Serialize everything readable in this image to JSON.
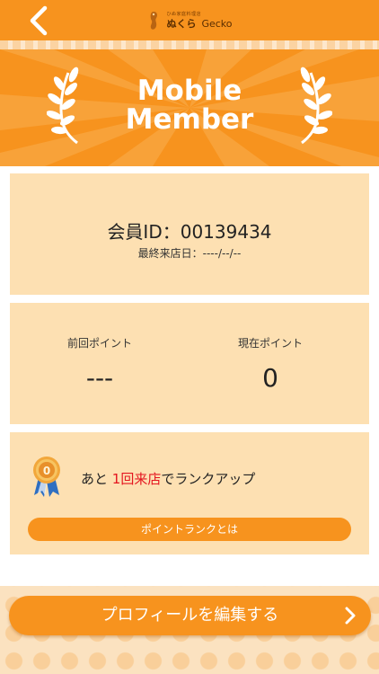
{
  "header": {
    "back_icon": "chevron-left-icon",
    "logo": {
      "small_text": "ひぬ家庭料理店",
      "name_jp": "ぬくら",
      "name_en": "Gecko"
    }
  },
  "banner": {
    "title_line1": "Mobile",
    "title_line2": "Member",
    "icon": "laurel-wreath-icon"
  },
  "member": {
    "id_text": "会員ID：00139434",
    "last_visit_text": "最終来店日：----/--/--"
  },
  "points": {
    "previous_label": "前回ポイント",
    "previous_value": "---",
    "current_label": "現在ポイント",
    "current_value": "0"
  },
  "rank": {
    "medal_icon": "medal-icon",
    "medal_number": "0",
    "msg_prefix": "あと ",
    "msg_highlight": "1回来店",
    "msg_suffix": "でランクアップ",
    "link_label": "ポイントランクとは"
  },
  "footer": {
    "edit_profile_label": "プロフィールを編集する",
    "chevron_icon": "chevron-right-icon"
  },
  "colors": {
    "brand_orange": "#f7931e",
    "card_bg": "#fde0b2",
    "highlight_red": "#e4151f"
  }
}
